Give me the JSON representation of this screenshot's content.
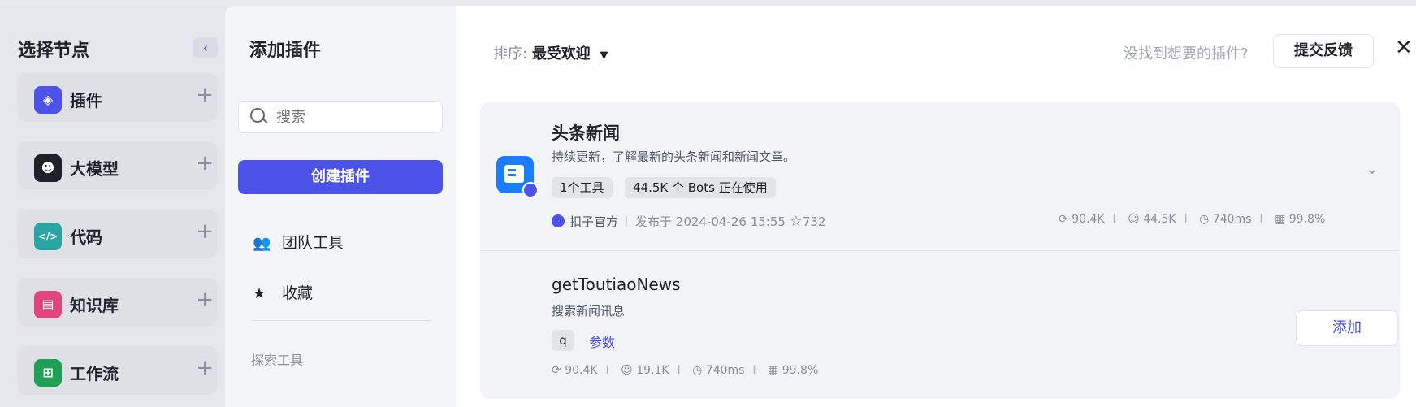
{
  "node_panel": {
    "title": "选择节点",
    "collapse_glyph": "‹",
    "add_glyph": "+",
    "items": [
      {
        "label": "插件",
        "icon": "cube-icon",
        "color": "#4d53e8",
        "glyph": "◈"
      },
      {
        "label": "大模型",
        "icon": "robot-face-icon",
        "color": "#1f2329",
        "glyph": "☻"
      },
      {
        "label": "代码",
        "icon": "code-icon",
        "color": "#2ba4a4",
        "glyph": "</>"
      },
      {
        "label": "知识库",
        "icon": "book-icon",
        "color": "#e0457b",
        "glyph": "▤"
      },
      {
        "label": "工作流",
        "icon": "workflow-icon",
        "color": "#1fa055",
        "glyph": "⊞"
      }
    ]
  },
  "modal": {
    "title": "添加插件",
    "search": {
      "placeholder": "搜索"
    },
    "create_button": "创建插件",
    "sidebar_items": [
      {
        "label": "团队工具",
        "icon": "team-icon",
        "glyph": "👥"
      },
      {
        "label": "收藏",
        "icon": "star-filled-icon",
        "glyph": "★"
      }
    ],
    "explore_section": "探索工具",
    "sort_label": "排序:",
    "sort_value": "最受欢迎",
    "sort_caret": "▼",
    "no_find_text": "没找到想要的插件?",
    "feedback_button": "提交反馈",
    "close_glyph": "✕",
    "plugin": {
      "name": "头条新闻",
      "description": "持续更新，了解最新的头条新闻和新闻文章。",
      "tags": [
        "1个工具",
        "44.5K 个 Bots 正在使用"
      ],
      "publisher": "扣子官方",
      "published": "发布于 2024-04-26 15:55",
      "favorites": "732",
      "stats": {
        "calls": "90.4K",
        "bots": "44.5K",
        "latency": "740ms",
        "success": "99.8%"
      },
      "chevron": "⌄"
    },
    "tool": {
      "name": "getToutiaoNews",
      "description": "搜索新闻讯息",
      "param_chip": "q",
      "param_link": "参数",
      "stats": {
        "calls": "90.4K",
        "bots": "19.1K",
        "latency": "740ms",
        "success": "99.8%"
      },
      "add_button": "添加"
    }
  }
}
